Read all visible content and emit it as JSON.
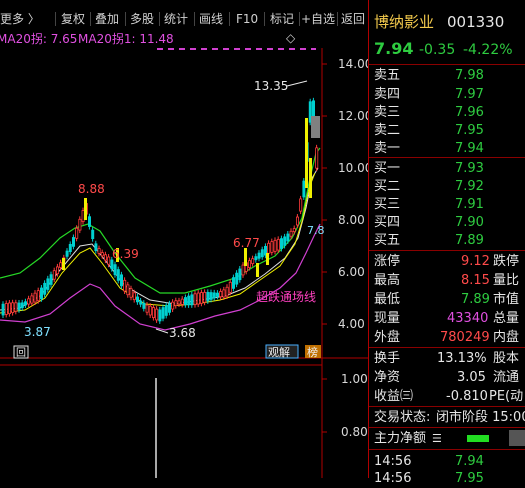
{
  "toolbar": {
    "items": [
      "更多 〉",
      "复权",
      "叠加",
      "多股",
      "统计",
      "画线",
      "F10",
      "标记",
      "+自选",
      "返回"
    ]
  },
  "indicator": {
    "ma20_yesterday": "MA20拐: 7.65",
    "ma20_today": "MA20拐1: 11.48",
    "diamond": "◇"
  },
  "chart": {
    "y_ticks": [
      "14.00",
      "12.00",
      "10.00",
      "8.00",
      "6.00",
      "4.00"
    ],
    "annotations": {
      "high": "13.35",
      "peak1": "8.88",
      "peak2": "6.39",
      "peak3": "6.77",
      "low": "3.68",
      "left_low": "3.87",
      "right_edge": "7.8",
      "line_label": "超跌通场线",
      "tag_left": "回",
      "tag_mid": "观解",
      "tag_right": "榜"
    },
    "lower_y_ticks": [
      "1.00",
      "0.80"
    ]
  },
  "stock": {
    "name": "博纳影业",
    "code": "001330",
    "price": "7.94",
    "change": "-0.35",
    "change_pct": "-4.22%"
  },
  "asks": [
    {
      "label": "卖五",
      "price": "7.98"
    },
    {
      "label": "卖四",
      "price": "7.97"
    },
    {
      "label": "卖三",
      "price": "7.96"
    },
    {
      "label": "卖二",
      "price": "7.95"
    },
    {
      "label": "卖一",
      "price": "7.94"
    }
  ],
  "bids": [
    {
      "label": "买一",
      "price": "7.93"
    },
    {
      "label": "买二",
      "price": "7.92"
    },
    {
      "label": "买三",
      "price": "7.91"
    },
    {
      "label": "买四",
      "price": "7.90"
    },
    {
      "label": "买五",
      "price": "7.89"
    }
  ],
  "stats": [
    {
      "label": "涨停",
      "value": "9.12",
      "label2": "跌停"
    },
    {
      "label": "最高",
      "value": "8.15",
      "label2": "量比"
    },
    {
      "label": "最低",
      "value": "7.89",
      "label2": "市值"
    },
    {
      "label": "现量",
      "value": "43340",
      "label2": "总量"
    },
    {
      "label": "外盘",
      "value": "780249",
      "label2": "内盘"
    }
  ],
  "stats2": [
    {
      "label": "换手",
      "value": "13.13%",
      "label2": "股本"
    },
    {
      "label": "净资",
      "value": "3.05",
      "label2": "流通"
    },
    {
      "label": "收益㈢",
      "value": "-0.810",
      "label2": "PE(动"
    }
  ],
  "status": {
    "label": "交易状态:",
    "value": "闭市阶段 15:00"
  },
  "fund": {
    "label": "主力净额",
    "icon": "☰"
  },
  "ticks": [
    {
      "time": "14:56",
      "price": "7.94"
    },
    {
      "time": "14:56",
      "price": "7.95"
    }
  ],
  "colors": {
    "up": "#ff3b3b",
    "down": "#00d0d0",
    "ma_green": "#26d826",
    "ma_magenta": "#d040d0",
    "ma_yellow": "#f0f000",
    "ma_white": "#e0e0e0",
    "axis": "#b00000",
    "name": "#f2c94c"
  }
}
